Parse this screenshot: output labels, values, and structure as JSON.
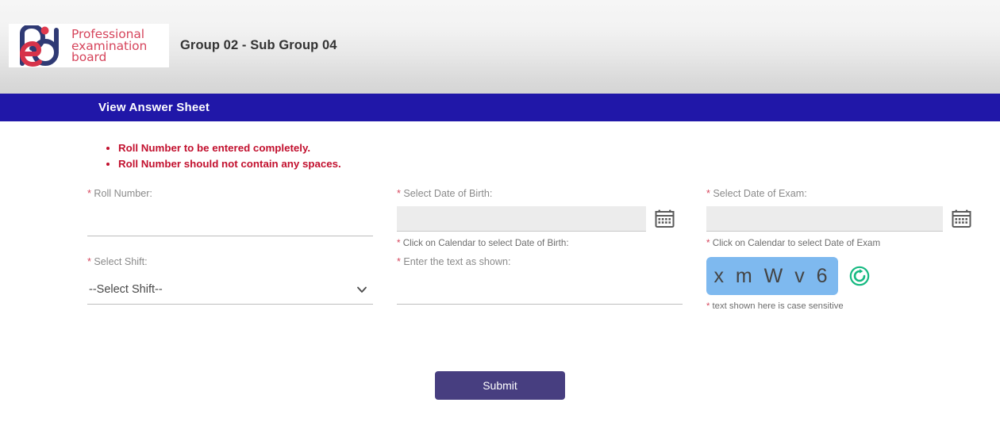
{
  "header": {
    "logo": {
      "monogram_icon": "peb-monogram-icon",
      "line1": "Professional",
      "line2": "examination",
      "line3": "board"
    },
    "title": "Group 02 - Sub Group 04"
  },
  "banner": {
    "title": "View Answer Sheet",
    "color": "#2017a8"
  },
  "notes": [
    "Roll Number to be entered completely.",
    "Roll Number should not contain any spaces."
  ],
  "form": {
    "roll_number": {
      "label": "Roll Number:",
      "required_mark": "*",
      "value": "",
      "placeholder": ""
    },
    "date_of_birth": {
      "label": "Select Date of Birth:",
      "required_mark": "*",
      "value": "",
      "placeholder": "",
      "hint": "Click on Calendar to select Date of Birth:",
      "hint_required_mark": "*",
      "calendar_icon": "calendar-icon"
    },
    "date_of_exam": {
      "label": "Select Date of Exam:",
      "required_mark": "*",
      "value": "",
      "placeholder": "",
      "hint": "Click on Calendar to select Date of Exam",
      "hint_required_mark": "*",
      "calendar_icon": "calendar-icon"
    },
    "shift": {
      "label": "Select Shift:",
      "required_mark": "*",
      "selected": "--Select Shift--",
      "options": [
        "--Select Shift--"
      ],
      "chevron_icon": "chevron-down-icon"
    },
    "captcha_text_field": {
      "label": "Enter the text as shown:",
      "required_mark": "*",
      "value": "",
      "placeholder": ""
    },
    "captcha": {
      "text": "x m W v 6",
      "background_color": "#7eb9ef",
      "refresh_icon": "refresh-icon",
      "refresh_color": "#16b981",
      "note": "text shown here is case sensitive",
      "note_required_mark": "*"
    },
    "submit": {
      "label": "Submit",
      "color": "#473e80"
    }
  }
}
